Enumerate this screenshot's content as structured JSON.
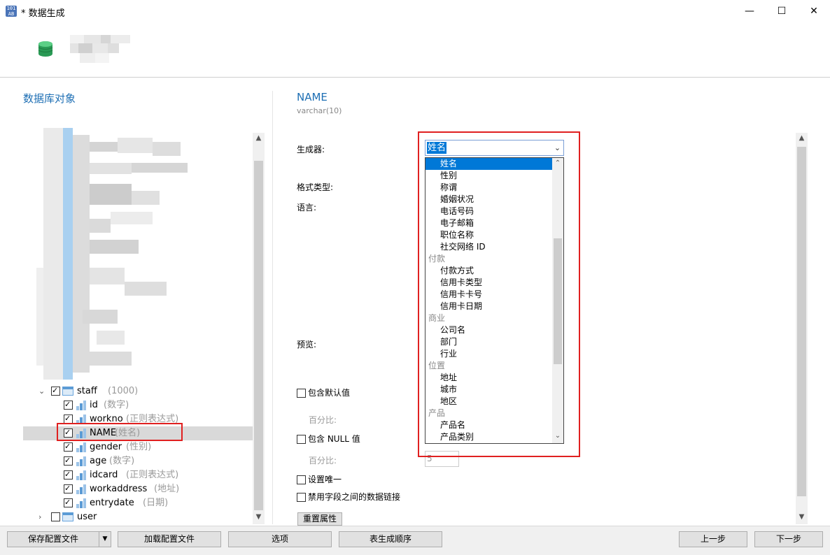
{
  "window": {
    "title": "* 数据生成",
    "app_icon_text": "101\nAB",
    "minimize": "—",
    "maximize": "☐",
    "close": "✕"
  },
  "left_panel": {
    "title": "数据库对象",
    "tree": [
      {
        "name": "staff",
        "hint": "(1000)",
        "type": "table",
        "expanded": true,
        "checked": true
      },
      {
        "name": "id",
        "hint": "(数字)",
        "type": "column",
        "checked": true
      },
      {
        "name": "workno",
        "hint": "(正则表达式)",
        "type": "column",
        "checked": true
      },
      {
        "name": "NAME",
        "hint": "(姓名)",
        "type": "column",
        "checked": true,
        "selected": true
      },
      {
        "name": "gender",
        "hint": "(性别)",
        "type": "column",
        "checked": true
      },
      {
        "name": "age",
        "hint": "(数字)",
        "type": "column",
        "checked": true
      },
      {
        "name": "idcard",
        "hint": "(正则表达式)",
        "type": "column",
        "checked": true
      },
      {
        "name": "workaddress",
        "hint": "(地址)",
        "type": "column",
        "checked": true
      },
      {
        "name": "entrydate",
        "hint": "(日期)",
        "type": "column",
        "checked": true
      },
      {
        "name": "user",
        "hint": "",
        "type": "table",
        "expanded": false,
        "checked": false
      }
    ]
  },
  "field": {
    "name": "NAME",
    "type": "varchar(10)"
  },
  "labels": {
    "generator": "生成器:",
    "format_type": "格式类型:",
    "language": "语言:",
    "preview": "预览:",
    "include_default": "包含默认值",
    "percent1": "百分比:",
    "include_null": "包含 NULL 值",
    "percent2": "百分比:",
    "unique": "设置唯一",
    "disable_link": "禁用字段之间的数据链接",
    "reset": "重置属性"
  },
  "null_percent_value": "5",
  "generator_combo": {
    "value": "姓名"
  },
  "dropdown_items": [
    {
      "label": "姓名",
      "kind": "item",
      "selected": true
    },
    {
      "label": "性别",
      "kind": "item"
    },
    {
      "label": "称谓",
      "kind": "item"
    },
    {
      "label": "婚姻状况",
      "kind": "item"
    },
    {
      "label": "电话号码",
      "kind": "item"
    },
    {
      "label": "电子邮箱",
      "kind": "item"
    },
    {
      "label": "职位名称",
      "kind": "item"
    },
    {
      "label": "社交网络 ID",
      "kind": "item"
    },
    {
      "label": "付款",
      "kind": "group"
    },
    {
      "label": "付款方式",
      "kind": "item"
    },
    {
      "label": "信用卡类型",
      "kind": "item"
    },
    {
      "label": "信用卡卡号",
      "kind": "item"
    },
    {
      "label": "信用卡日期",
      "kind": "item"
    },
    {
      "label": "商业",
      "kind": "group"
    },
    {
      "label": "公司名",
      "kind": "item"
    },
    {
      "label": "部门",
      "kind": "item"
    },
    {
      "label": "行业",
      "kind": "item"
    },
    {
      "label": "位置",
      "kind": "group"
    },
    {
      "label": "地址",
      "kind": "item"
    },
    {
      "label": "城市",
      "kind": "item"
    },
    {
      "label": "地区",
      "kind": "item"
    },
    {
      "label": "产品",
      "kind": "group"
    },
    {
      "label": "产品名",
      "kind": "item"
    },
    {
      "label": "产品类别",
      "kind": "item"
    }
  ],
  "bottom_buttons": {
    "save_profile": "保存配置文件",
    "load_profile": "加载配置文件",
    "options": "选项",
    "table_order": "表生成顺序",
    "prev": "上一步",
    "next": "下一步"
  },
  "colors": {
    "accent": "#1e6fb4",
    "selection": "#0078d7",
    "highlight_box": "#e02020"
  }
}
